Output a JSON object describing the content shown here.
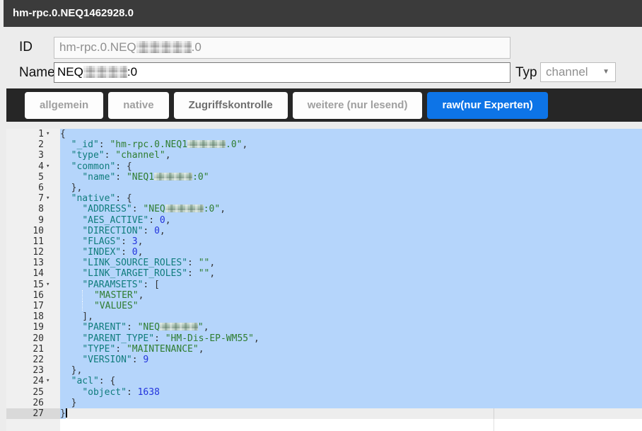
{
  "window": {
    "title": "hm-rpc.0.NEQ1462928.0"
  },
  "form": {
    "id_label": "ID",
    "id_value": {
      "prefix": "hm-rpc.0.NEQ",
      "redacted": true,
      "suffix": ".0"
    },
    "name_label": "Name",
    "name_value": {
      "prefix": "NEQ",
      "redacted": true,
      "suffix": ":0"
    },
    "type_label": "Typ",
    "type_selected": "channel",
    "type_dropdown_icon": "chevron-down-icon"
  },
  "tabs": [
    {
      "label": "allgemein",
      "active": false
    },
    {
      "label": "native",
      "active": false
    },
    {
      "label": "Zugriffskontrolle",
      "active": false
    },
    {
      "label": "weitere (nur lesend)",
      "active": false
    },
    {
      "label": "raw(nur Experten)",
      "active": true
    }
  ],
  "colors": {
    "titlebar": "#3b3b3b",
    "tabbar": "#262626",
    "accent": "#0d74e7",
    "selection": "#b5d5fb",
    "gutter": "#f0f0f0",
    "key": "#0f7c7c",
    "string": "#2f7d30",
    "number": "#2233dd"
  },
  "editor": {
    "cursor_line": 27,
    "lines": [
      {
        "n": 1,
        "fold": true,
        "sel": true,
        "seg": [
          [
            "p",
            "{"
          ]
        ]
      },
      {
        "n": 2,
        "sel": true,
        "seg": [
          [
            "p",
            "  "
          ],
          [
            "k",
            "\"_id\""
          ],
          [
            "p",
            ": "
          ],
          [
            "s",
            "\"hm-rpc.0.NEQ1"
          ],
          [
            "r",
            ""
          ],
          [
            "s",
            ".0\""
          ],
          [
            "p",
            ","
          ]
        ]
      },
      {
        "n": 3,
        "sel": true,
        "seg": [
          [
            "p",
            "  "
          ],
          [
            "k",
            "\"type\""
          ],
          [
            "p",
            ": "
          ],
          [
            "s",
            "\"channel\""
          ],
          [
            "p",
            ","
          ]
        ]
      },
      {
        "n": 4,
        "fold": true,
        "sel": true,
        "seg": [
          [
            "p",
            "  "
          ],
          [
            "k",
            "\"common\""
          ],
          [
            "p",
            ": {"
          ]
        ]
      },
      {
        "n": 5,
        "sel": true,
        "seg": [
          [
            "p",
            "    "
          ],
          [
            "k",
            "\"name\""
          ],
          [
            "p",
            ": "
          ],
          [
            "s",
            "\"NEQ1"
          ],
          [
            "r",
            ""
          ],
          [
            "s",
            ":0\""
          ]
        ]
      },
      {
        "n": 6,
        "sel": true,
        "seg": [
          [
            "p",
            "  },"
          ]
        ]
      },
      {
        "n": 7,
        "fold": true,
        "sel": true,
        "seg": [
          [
            "p",
            "  "
          ],
          [
            "k",
            "\"native\""
          ],
          [
            "p",
            ": {"
          ]
        ]
      },
      {
        "n": 8,
        "sel": true,
        "seg": [
          [
            "p",
            "    "
          ],
          [
            "k",
            "\"ADDRESS\""
          ],
          [
            "p",
            ": "
          ],
          [
            "s",
            "\"NEQ"
          ],
          [
            "r",
            ""
          ],
          [
            "s",
            ":0\""
          ],
          [
            "p",
            ","
          ]
        ]
      },
      {
        "n": 9,
        "sel": true,
        "seg": [
          [
            "p",
            "    "
          ],
          [
            "k",
            "\"AES_ACTIVE\""
          ],
          [
            "p",
            ": "
          ],
          [
            "n",
            "0"
          ],
          [
            "p",
            ","
          ]
        ]
      },
      {
        "n": 10,
        "sel": true,
        "seg": [
          [
            "p",
            "    "
          ],
          [
            "k",
            "\"DIRECTION\""
          ],
          [
            "p",
            ": "
          ],
          [
            "n",
            "0"
          ],
          [
            "p",
            ","
          ]
        ]
      },
      {
        "n": 11,
        "sel": true,
        "seg": [
          [
            "p",
            "    "
          ],
          [
            "k",
            "\"FLAGS\""
          ],
          [
            "p",
            ": "
          ],
          [
            "n",
            "3"
          ],
          [
            "p",
            ","
          ]
        ]
      },
      {
        "n": 12,
        "sel": true,
        "seg": [
          [
            "p",
            "    "
          ],
          [
            "k",
            "\"INDEX\""
          ],
          [
            "p",
            ": "
          ],
          [
            "n",
            "0"
          ],
          [
            "p",
            ","
          ]
        ]
      },
      {
        "n": 13,
        "sel": true,
        "seg": [
          [
            "p",
            "    "
          ],
          [
            "k",
            "\"LINK_SOURCE_ROLES\""
          ],
          [
            "p",
            ": "
          ],
          [
            "s",
            "\"\""
          ],
          [
            "p",
            ","
          ]
        ]
      },
      {
        "n": 14,
        "sel": true,
        "seg": [
          [
            "p",
            "    "
          ],
          [
            "k",
            "\"LINK_TARGET_ROLES\""
          ],
          [
            "p",
            ": "
          ],
          [
            "s",
            "\"\""
          ],
          [
            "p",
            ","
          ]
        ]
      },
      {
        "n": 15,
        "fold": true,
        "sel": true,
        "seg": [
          [
            "p",
            "    "
          ],
          [
            "k",
            "\"PARAMSETS\""
          ],
          [
            "p",
            ": ["
          ]
        ]
      },
      {
        "n": 16,
        "sel": true,
        "seg": [
          [
            "p",
            "    "
          ],
          [
            "g",
            ""
          ],
          [
            "p",
            "  "
          ],
          [
            "s",
            "\"MASTER\""
          ],
          [
            "p",
            ","
          ]
        ]
      },
      {
        "n": 17,
        "sel": true,
        "seg": [
          [
            "p",
            "    "
          ],
          [
            "g",
            ""
          ],
          [
            "p",
            "  "
          ],
          [
            "s",
            "\"VALUES\""
          ]
        ]
      },
      {
        "n": 18,
        "sel": true,
        "seg": [
          [
            "p",
            "    ],"
          ]
        ]
      },
      {
        "n": 19,
        "sel": true,
        "seg": [
          [
            "p",
            "    "
          ],
          [
            "k",
            "\"PARENT\""
          ],
          [
            "p",
            ": "
          ],
          [
            "s",
            "\"NEQ"
          ],
          [
            "r",
            ""
          ],
          [
            "s",
            "\""
          ],
          [
            "p",
            ","
          ]
        ]
      },
      {
        "n": 20,
        "sel": true,
        "seg": [
          [
            "p",
            "    "
          ],
          [
            "k",
            "\"PARENT_TYPE\""
          ],
          [
            "p",
            ": "
          ],
          [
            "s",
            "\"HM-Dis-EP-WM55\""
          ],
          [
            "p",
            ","
          ]
        ]
      },
      {
        "n": 21,
        "sel": true,
        "seg": [
          [
            "p",
            "    "
          ],
          [
            "k",
            "\"TYPE\""
          ],
          [
            "p",
            ": "
          ],
          [
            "s",
            "\"MAINTENANCE\""
          ],
          [
            "p",
            ","
          ]
        ]
      },
      {
        "n": 22,
        "sel": true,
        "seg": [
          [
            "p",
            "    "
          ],
          [
            "k",
            "\"VERSION\""
          ],
          [
            "p",
            ": "
          ],
          [
            "n",
            "9"
          ]
        ]
      },
      {
        "n": 23,
        "sel": true,
        "seg": [
          [
            "p",
            "  },"
          ]
        ]
      },
      {
        "n": 24,
        "fold": true,
        "sel": true,
        "seg": [
          [
            "p",
            "  "
          ],
          [
            "k",
            "\"acl\""
          ],
          [
            "p",
            ": {"
          ]
        ]
      },
      {
        "n": 25,
        "sel": true,
        "seg": [
          [
            "p",
            "    "
          ],
          [
            "k",
            "\"object\""
          ],
          [
            "p",
            ": "
          ],
          [
            "n",
            "1638"
          ]
        ]
      },
      {
        "n": 26,
        "sel": true,
        "seg": [
          [
            "p",
            "  }"
          ]
        ]
      },
      {
        "n": 27,
        "active": true,
        "cursor": true,
        "seg": [
          [
            "ps",
            "}"
          ]
        ]
      }
    ]
  }
}
